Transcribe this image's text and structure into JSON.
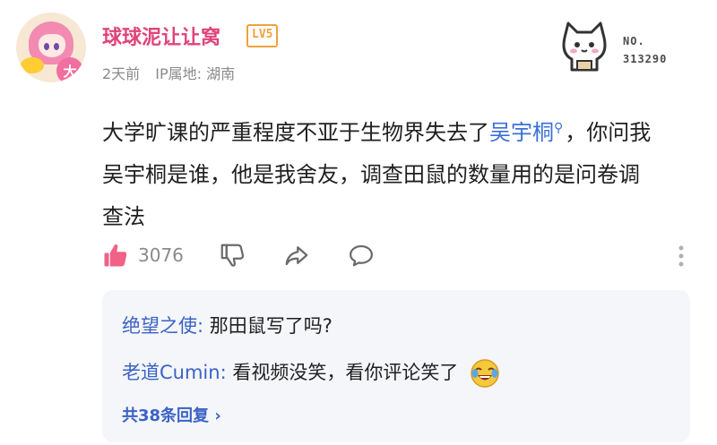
{
  "post": {
    "username": "球球泥让让窝",
    "level": "LV5",
    "time": "2天前",
    "ip_location": "IP属地: 湖南",
    "sticker_no_label": "NO.",
    "sticker_no_value": "313290",
    "content_part1": "大学旷课的严重程度不亚于生物界失去了",
    "content_highlight": "吴宇桐",
    "content_part2": "，你问我吴宇桐是谁，他是我舍友，调查田鼠的数量用的是问卷调查法"
  },
  "actions": {
    "like_count": "3076"
  },
  "replies": {
    "items": [
      {
        "author": "绝望之使:",
        "text": " 那田鼠写了吗?"
      },
      {
        "author": "老道Cumin:",
        "text": " 看视频没笑，看你评论笑了"
      }
    ],
    "more_label": "共38条回复 ›"
  },
  "colors": {
    "username": "#e0447a",
    "link": "#3b6fd8",
    "reply_author": "#3b62c4",
    "level_badge": "#f1a23a",
    "reply_bg": "#f4f6fa"
  },
  "icons": [
    "like-icon",
    "dislike-icon",
    "share-icon",
    "comment-icon",
    "more-icon",
    "search-icon",
    "cat-sticker-icon",
    "laugh-emoji-icon"
  ]
}
